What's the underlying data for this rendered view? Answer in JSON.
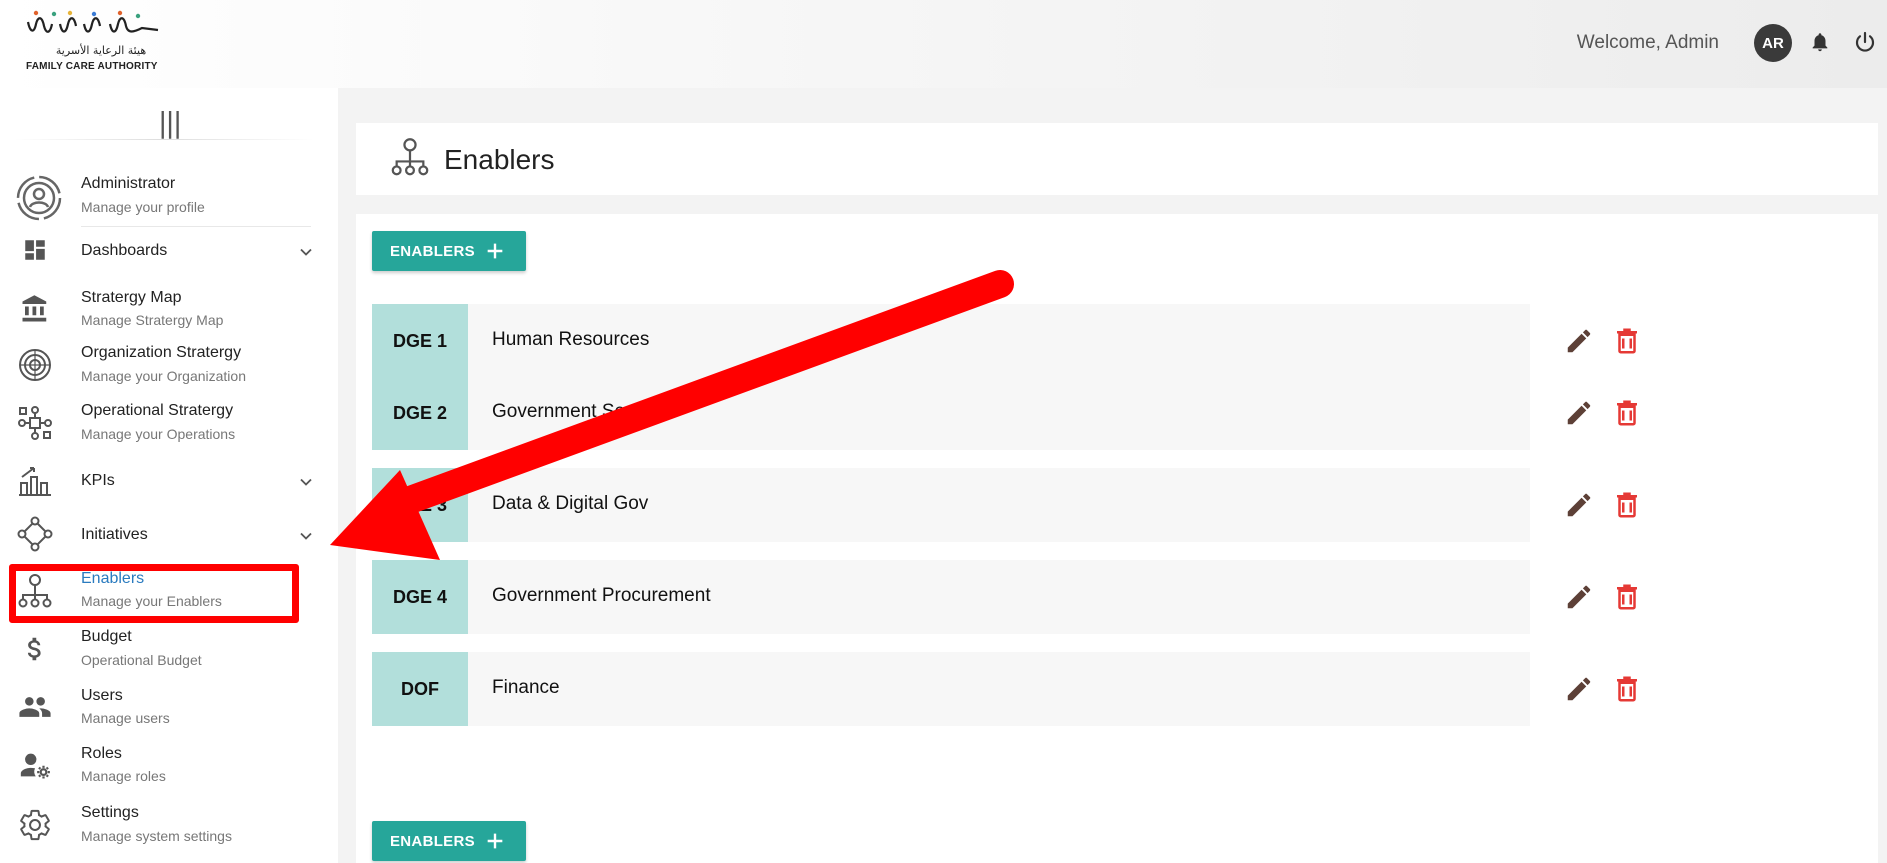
{
  "header": {
    "logo_arabic": "هيئة الرعاية الأسرية",
    "logo_english": "FAMILY CARE AUTHORITY",
    "welcome": "Welcome,  Admin",
    "avatar_initials": "AR",
    "icons": [
      "bell-icon",
      "power-icon"
    ]
  },
  "sidebar": {
    "collapse_glyph": "|||",
    "items": [
      {
        "title": "Administrator",
        "subtitle": "Manage your profile",
        "icon": "user-circle-icon"
      },
      {
        "title": "Dashboards",
        "subtitle": "",
        "icon": "dashboard-icon",
        "expandable": true
      },
      {
        "title": "Stratergy Map",
        "subtitle": "Manage Stratergy Map",
        "icon": "bank-icon"
      },
      {
        "title": "Organization Stratergy",
        "subtitle": "Manage your Organization",
        "icon": "target-icon"
      },
      {
        "title": "Operational Stratergy",
        "subtitle": "Manage your Operations",
        "icon": "network-icon"
      },
      {
        "title": "KPIs",
        "subtitle": "",
        "icon": "chart-growth-icon",
        "expandable": true
      },
      {
        "title": "Initiatives",
        "subtitle": "",
        "icon": "diamond-nodes-icon",
        "expandable": true
      },
      {
        "title": "Enablers",
        "subtitle": "Manage your Enablers",
        "icon": "hierarchy-icon",
        "active": true
      },
      {
        "title": "Budget",
        "subtitle": "Operational Budget",
        "icon": "dollar-icon"
      },
      {
        "title": "Users",
        "subtitle": "Manage users",
        "icon": "users-icon"
      },
      {
        "title": "Roles",
        "subtitle": "Manage roles",
        "icon": "user-gear-icon"
      },
      {
        "title": "Settings",
        "subtitle": "Manage system settings",
        "icon": "gear-icon"
      }
    ]
  },
  "page": {
    "title": "Enablers",
    "add_button_label": "ENABLERS",
    "rows": [
      {
        "code": "DGE 1",
        "name": "Human Resources"
      },
      {
        "code": "DGE 2",
        "name": "Government Services"
      },
      {
        "code": "DGE 3",
        "name": "Data & Digital Gov"
      },
      {
        "code": "DGE 4",
        "name": "Government Procurement"
      },
      {
        "code": "DOF",
        "name": "Finance"
      }
    ]
  },
  "colors": {
    "accent": "#26a69a",
    "code_bg": "#b2dfdb",
    "active_link": "#2a7bbf",
    "delete": "#e53935",
    "edit": "#5d4037",
    "annotation": "#ff0000"
  }
}
